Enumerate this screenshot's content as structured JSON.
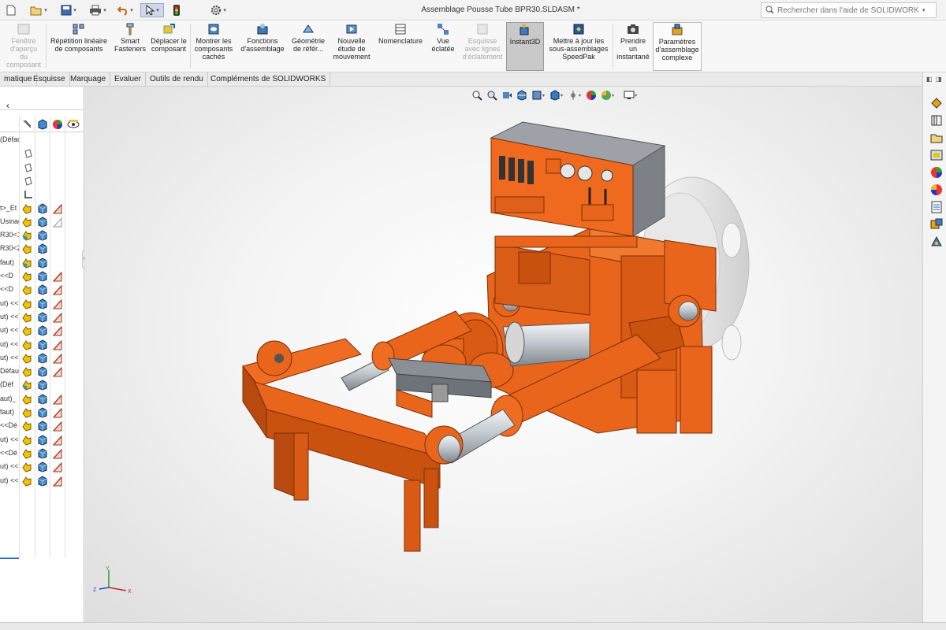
{
  "window": {
    "title": "Assemblage Pousse Tube BPR30.SLDASM *",
    "search_placeholder": "Rechercher dans l'aide de SOLIDWORKS"
  },
  "quick_access": [
    "new-icon",
    "open-icon",
    "save-icon",
    "print-icon",
    "undo-icon",
    "select-icon",
    "rebuild-icon",
    "options-icon"
  ],
  "ribbon": {
    "buttons": [
      {
        "label": "Fenêtre\nd'aperçu\ndu\ncomposant",
        "icon": "preview-window-icon",
        "disabled": true
      },
      {
        "label": "Répétition linéaire\nde composants",
        "icon": "linear-pattern-icon",
        "disabled": false
      },
      {
        "label": "Smart\nFasteners",
        "icon": "smart-fasteners-icon",
        "disabled": false
      },
      {
        "label": "Déplacer le\ncomposant",
        "icon": "move-component-icon",
        "disabled": false
      },
      {
        "label": "Montrer les\ncomposants\ncachés",
        "icon": "show-hidden-icon",
        "disabled": false
      },
      {
        "label": "Fonctions\nd'assemblage",
        "icon": "assembly-features-icon",
        "disabled": false
      },
      {
        "label": "Géométrie\nde référ...",
        "icon": "reference-geometry-icon",
        "disabled": false
      },
      {
        "label": "Nouvelle\nétude de\nmouvement",
        "icon": "motion-study-icon",
        "disabled": false
      },
      {
        "label": "Nomenclature",
        "icon": "bom-icon",
        "disabled": false
      },
      {
        "label": "Vue\néclatée",
        "icon": "exploded-view-icon",
        "disabled": false
      },
      {
        "label": "Esquisse\navec lignes\nd'éclatement",
        "icon": "explode-line-sketch-icon",
        "disabled": true
      },
      {
        "label": "Instant3D",
        "icon": "instant3d-icon",
        "disabled": false,
        "active": true
      },
      {
        "label": "Mettre à jour les\nsous-assemblages\nSpeedPak",
        "icon": "speedpak-icon",
        "disabled": false
      },
      {
        "label": "Prendre\nun\ninstantané",
        "icon": "snapshot-icon",
        "disabled": false
      },
      {
        "label": "Paramètres\nd'assemblage\ncomplexe",
        "icon": "large-assembly-icon",
        "disabled": false,
        "framed": true
      }
    ]
  },
  "tabs": [
    "matique",
    "Esquisse",
    "Marquage",
    "Evaluer",
    "Outils de rendu",
    "Compléments de SOLIDWORKS"
  ],
  "left_panel": {
    "collapse_glyph": "‹",
    "tree_rows": [
      {
        "label": "(Défau",
        "icons": []
      },
      {
        "label": "",
        "icons": [
          "plane"
        ]
      },
      {
        "label": "",
        "icons": [
          "plane"
        ]
      },
      {
        "label": "",
        "icons": [
          "plane"
        ]
      },
      {
        "label": "",
        "icons": [
          "origin"
        ]
      },
      {
        "label": "t>_Et",
        "icons": [
          "mate",
          "part",
          "sketch"
        ]
      },
      {
        "label": "Usinag",
        "icons": [
          "mate",
          "part",
          "sketch-light"
        ]
      },
      {
        "label": "R30<1",
        "icons": [
          "mate-color",
          "part"
        ]
      },
      {
        "label": "R30<2",
        "icons": [
          "mate",
          "part"
        ]
      },
      {
        "label": "faut)",
        "icons": [
          "mate-color",
          "part"
        ]
      },
      {
        "label": "<<D",
        "icons": [
          "mate",
          "part",
          "sketch"
        ]
      },
      {
        "label": "<<D",
        "icons": [
          "mate",
          "part",
          "sketch"
        ]
      },
      {
        "label": "ut) <<",
        "icons": [
          "mate",
          "part",
          "sketch"
        ]
      },
      {
        "label": "ut) <<",
        "icons": [
          "mate",
          "part",
          "sketch"
        ]
      },
      {
        "label": "ut) <<",
        "icons": [
          "mate",
          "part",
          "sketch"
        ]
      },
      {
        "label": "ut) <<",
        "icons": [
          "mate",
          "part",
          "sketch"
        ]
      },
      {
        "label": "ut) <<",
        "icons": [
          "mate",
          "part",
          "sketch"
        ]
      },
      {
        "label": "Défaut",
        "icons": [
          "mate",
          "part",
          "sketch"
        ]
      },
      {
        "label": "(Déf",
        "icons": [
          "mate-color",
          "part"
        ]
      },
      {
        "label": "aut)_",
        "icons": [
          "mate",
          "part",
          "sketch"
        ]
      },
      {
        "label": "faut)",
        "icons": [
          "mate",
          "part",
          "sketch"
        ]
      },
      {
        "label": "<<Dé",
        "icons": [
          "mate",
          "part",
          "sketch"
        ]
      },
      {
        "label": "ut) <<",
        "icons": [
          "mate",
          "part",
          "sketch"
        ]
      },
      {
        "label": "<<Dé",
        "icons": [
          "mate",
          "part",
          "sketch"
        ]
      },
      {
        "label": "ut) <<",
        "icons": [
          "mate",
          "part",
          "sketch"
        ]
      },
      {
        "label": "ut) <<",
        "icons": [
          "mate",
          "part",
          "sketch"
        ]
      }
    ]
  },
  "view_toolbar": [
    "zoom-fit-icon",
    "zoom-area-icon",
    "previous-view-icon",
    "section-view-icon",
    "dynamic-annotation-icon",
    "view-orientation-icon",
    "display-style-icon",
    "hide-show-icon",
    "edit-appearance-icon",
    "apply-scene-icon",
    "view-settings-icon"
  ],
  "task_pane": [
    "resources-icon",
    "design-library-icon",
    "file-explorer-icon",
    "view-palette-icon",
    "appearances-icon",
    "custom-properties-icon",
    "forum-icon",
    "3dexperience-icon",
    "solidworks-resources-icon"
  ],
  "colors": {
    "model_orange": "#e8651b",
    "model_orange_dark": "#b54a10",
    "steel": "#c9ced4",
    "cabinet_grey": "#8f9299",
    "viewport_bg": "#efefef"
  },
  "triad": {
    "x": "X",
    "y": "Y",
    "z": "Z"
  }
}
